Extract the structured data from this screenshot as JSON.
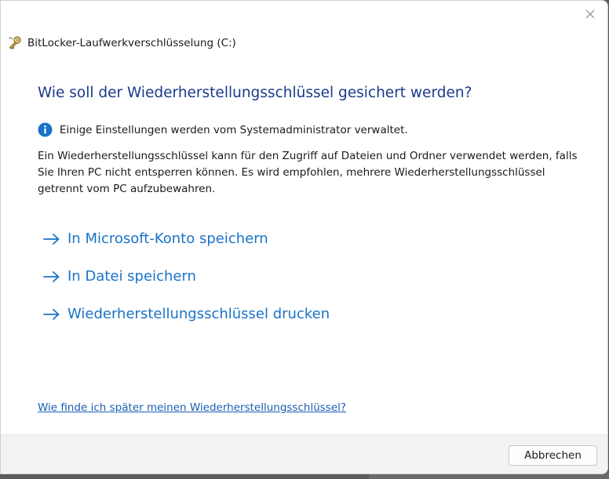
{
  "window": {
    "title": "BitLocker-Laufwerkverschlüsselung (C:)"
  },
  "content": {
    "heading": "Wie soll der Wiederherstellungsschlüssel gesichert werden?",
    "info_text": "Einige Einstellungen werden vom Systemadministrator verwaltet.",
    "description": "Ein Wiederherstellungsschlüssel kann für den Zugriff auf Dateien und Ordner verwendet werden, falls Sie Ihren PC nicht entsperren können. Es wird empfohlen, mehrere Wiederherstellungsschlüssel getrennt vom PC aufzubewahren.",
    "options": [
      {
        "label": "In Microsoft-Konto speichern"
      },
      {
        "label": "In Datei speichern"
      },
      {
        "label": "Wiederherstellungsschlüssel drucken"
      }
    ],
    "help_link": "Wie finde ich später meinen Wiederherstellungsschlüssel?"
  },
  "footer": {
    "cancel_label": "Abbrechen"
  },
  "icons": {
    "app": "bitlocker-key-icon",
    "info": "info-icon",
    "arrow": "arrow-right-icon",
    "close": "close-icon"
  },
  "colors": {
    "heading": "#1a3a8a",
    "link": "#1a73c8",
    "info_icon": "#1a73c8",
    "footer_bg": "#f3f3f3"
  }
}
